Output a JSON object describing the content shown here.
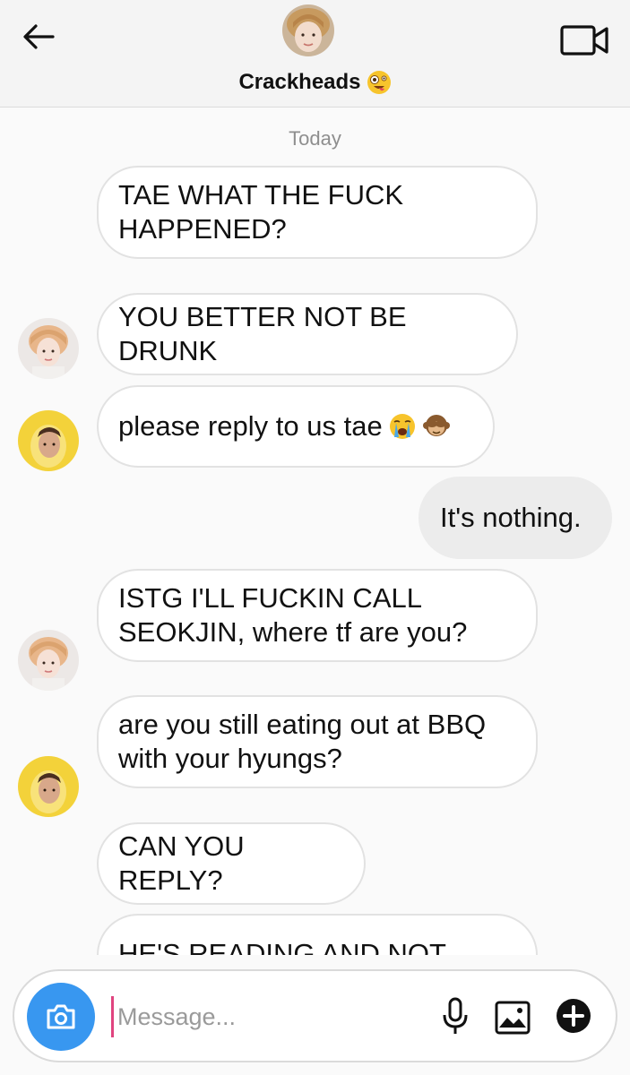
{
  "header": {
    "title": "Crackheads",
    "title_emoji": "zany-face-emoji",
    "back_icon": "arrow-left-icon",
    "video_icon": "video-camera-icon"
  },
  "thread": {
    "date_label": "Today",
    "messages": [
      {
        "sender": "other",
        "text": "TAE WHAT THE FUCK\nHAPPENED?"
      },
      {
        "sender": "other",
        "text": "YOU BETTER NOT BE DRUNK"
      },
      {
        "sender": "other",
        "text": "please reply to us tae",
        "emojis": [
          "crying-face-emoji",
          "see-no-evil-monkey-emoji"
        ]
      },
      {
        "sender": "me",
        "text": "It's nothing."
      },
      {
        "sender": "other",
        "text": "ISTG I'LL FUCKIN CALL\nSEOKJIN, where tf are you?"
      },
      {
        "sender": "other",
        "text": "are you still eating out at BBQ\nwith your hyungs?"
      },
      {
        "sender": "other",
        "text": "CAN YOU REPLY?"
      },
      {
        "sender": "other",
        "text": "HE'S READING AND NOT"
      }
    ]
  },
  "composer": {
    "placeholder": "Message...",
    "camera_icon": "camera-icon",
    "mic_icon": "microphone-icon",
    "gallery_icon": "image-icon",
    "plus_icon": "plus-circle-icon"
  },
  "colors": {
    "accent": "#3897f0",
    "sent_bubble": "#ececec",
    "received_bubble": "#ffffff",
    "caret": "#e0447f"
  }
}
